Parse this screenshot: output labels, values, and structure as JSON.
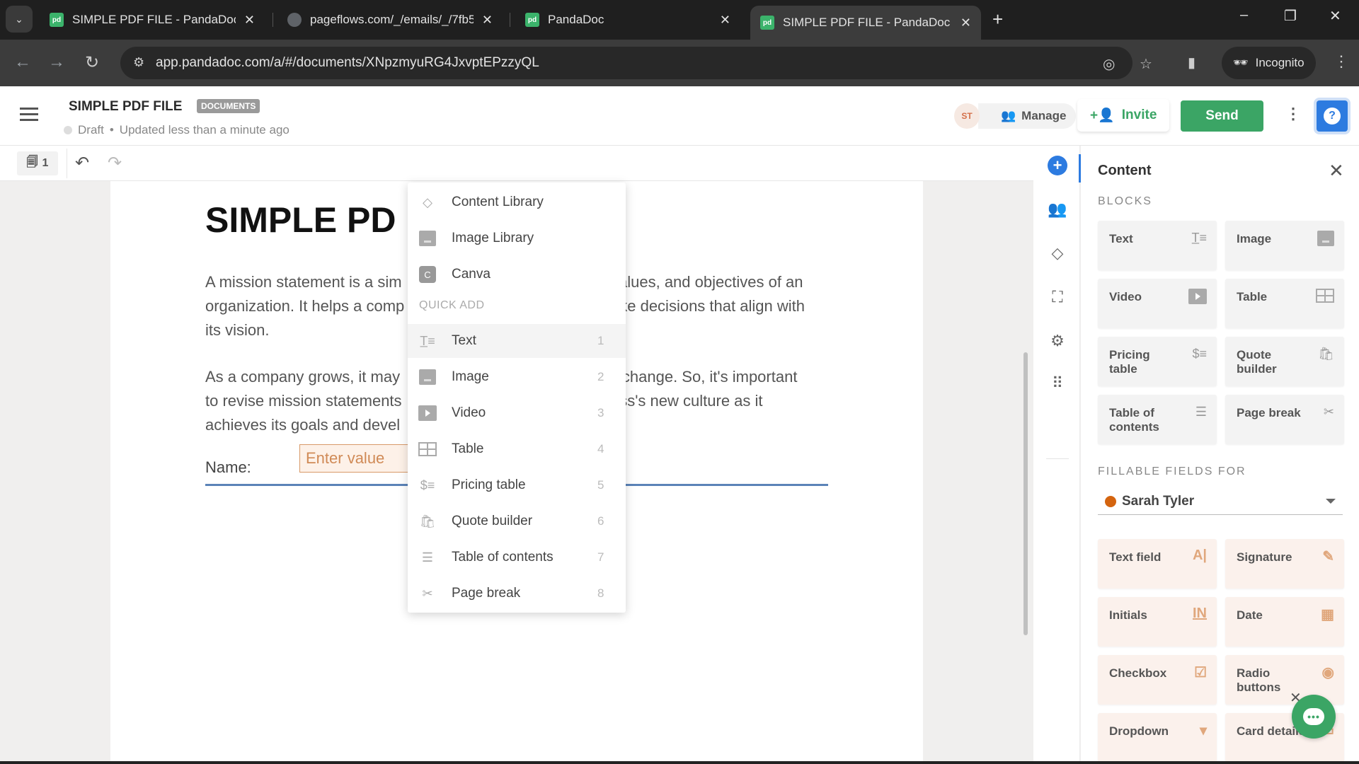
{
  "browser": {
    "tabs": [
      {
        "title": "SIMPLE PDF FILE - PandaDoc",
        "favicon": "pd",
        "active": false
      },
      {
        "title": "pageflows.com/_/emails/_/7fb5",
        "favicon": "globe",
        "active": false
      },
      {
        "title": "PandaDoc",
        "favicon": "pd",
        "active": false
      },
      {
        "title": "SIMPLE PDF FILE - PandaDoc",
        "favicon": "pd",
        "active": true
      }
    ],
    "new_tab_label": "+",
    "url": "app.pandadoc.com/a/#/documents/XNpzmyuRG4JxvptEPzzyQL",
    "incognito_label": "Incognito"
  },
  "header": {
    "doc_title": "SIMPLE PDF FILE",
    "badge": "DOCUMENTS",
    "status": "Draft",
    "updated": "Updated less than a minute ago",
    "avatar_initials": "ST",
    "manage_label": "Manage",
    "invite_label": "Invite",
    "send_label": "Send",
    "help_label": "?"
  },
  "toolbar": {
    "page_count": "1"
  },
  "document": {
    "title": "SIMPLE PD",
    "para1": "A mission statement is a sim                                                   values, and objectives of an organization. It helps a comp                                            ake decisions that align with its vision.",
    "para1_left": [
      "A mission statement is a sim",
      "organization. It helps a comp",
      "its vision."
    ],
    "para1_right": [
      "values, and objectives of an",
      "ake decisions that align with",
      ""
    ],
    "para2_left": [
      "As a company grows, it may",
      "to revise mission statements",
      "achieves its goals and devel"
    ],
    "para2_right": [
      "ll change. So, it's important",
      "ess's new culture as it",
      ""
    ],
    "name_label": "Name:",
    "name_placeholder": "Enter value"
  },
  "menu": {
    "top_items": [
      {
        "label": "Content Library",
        "icon": "shapes-icon"
      },
      {
        "label": "Image Library",
        "icon": "image-icon"
      },
      {
        "label": "Canva",
        "icon": "canva-icon"
      }
    ],
    "section_label": "QUICK ADD",
    "quick_add": [
      {
        "label": "Text",
        "key": "1",
        "icon": "text-icon"
      },
      {
        "label": "Image",
        "key": "2",
        "icon": "image-icon"
      },
      {
        "label": "Video",
        "key": "3",
        "icon": "video-icon"
      },
      {
        "label": "Table",
        "key": "4",
        "icon": "table-icon"
      },
      {
        "label": "Pricing table",
        "key": "5",
        "icon": "pricing-table-icon"
      },
      {
        "label": "Quote builder",
        "key": "6",
        "icon": "bag-icon"
      },
      {
        "label": "Table of contents",
        "key": "7",
        "icon": "toc-icon"
      },
      {
        "label": "Page break",
        "key": "8",
        "icon": "scissors-icon"
      }
    ]
  },
  "panel": {
    "title": "Content",
    "blocks_label": "BLOCKS",
    "blocks": [
      {
        "label": "Text",
        "icon": "text-icon"
      },
      {
        "label": "Image",
        "icon": "image-icon"
      },
      {
        "label": "Video",
        "icon": "video-icon"
      },
      {
        "label": "Table",
        "icon": "table-icon"
      },
      {
        "label": "Pricing table",
        "icon": "pricing-table-icon"
      },
      {
        "label": "Quote builder",
        "icon": "bag-icon"
      },
      {
        "label": "Table of contents",
        "icon": "toc-icon"
      },
      {
        "label": "Page break",
        "icon": "scissors-icon"
      }
    ],
    "fillable_label": "FILLABLE FIELDS FOR",
    "recipient": {
      "name": "Sarah Tyler",
      "color": "#d4640f"
    },
    "fields": [
      {
        "label": "Text field",
        "icon": "A|"
      },
      {
        "label": "Signature",
        "icon": "✎"
      },
      {
        "label": "Initials",
        "icon": "IN"
      },
      {
        "label": "Date",
        "icon": "▦"
      },
      {
        "label": "Checkbox",
        "icon": "☑"
      },
      {
        "label": "Radio buttons",
        "icon": "◉"
      },
      {
        "label": "Dropdown",
        "icon": "▾"
      },
      {
        "label": "Card details",
        "icon": "▭"
      }
    ]
  },
  "colors": {
    "brand_green": "#3ba565",
    "accent_blue": "#2d7be0",
    "recipient_orange": "#d4640f"
  }
}
